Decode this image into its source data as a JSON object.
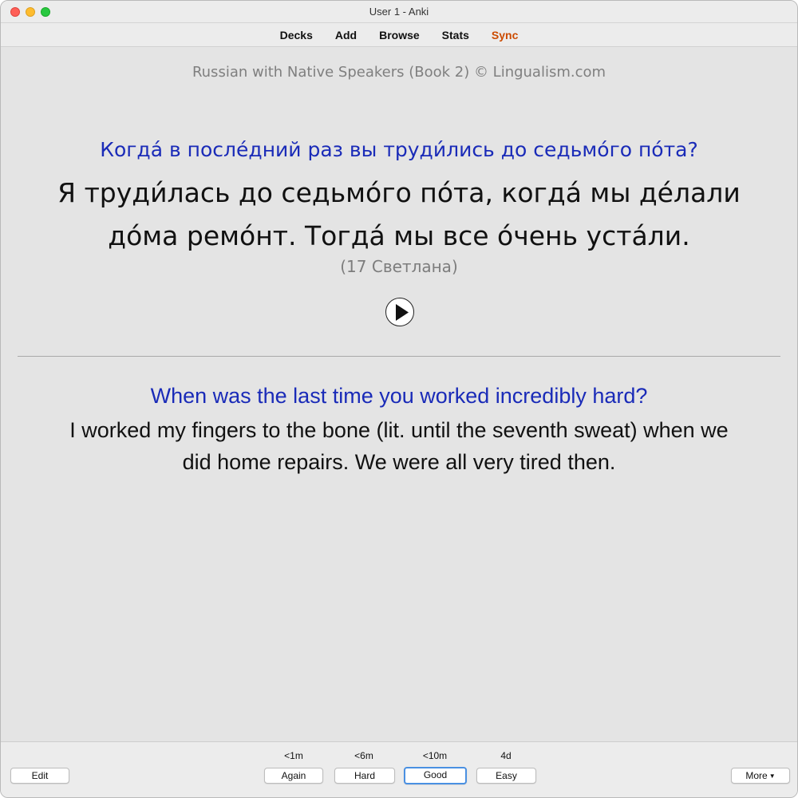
{
  "window": {
    "title": "User 1 - Anki"
  },
  "toolbar": {
    "items": [
      "Decks",
      "Add",
      "Browse",
      "Stats",
      "Sync"
    ]
  },
  "card": {
    "copyright": "Russian with Native Speakers (Book 2) © Lingualism.com",
    "ru_question": "Когда́ в после́дний раз вы труди́лись до седьмо́го по́та?",
    "ru_answer_line1": "Я труди́лась до седьмо́го по́та, когда́ мы де́лали",
    "ru_answer_line2": "до́ма ремо́нт. Тогда́ мы все о́чень уста́ли.",
    "speaker": "(17 Светлана)",
    "en_question": "When was the last time you worked incredibly hard?",
    "en_answer_line1": "I worked my fingers to the bone (lit. until the seventh sweat) when we",
    "en_answer_line2": "did home repairs. We were all very tired then."
  },
  "bottom": {
    "edit_label": "Edit",
    "more_label": "More",
    "answers": [
      {
        "interval": "<1m",
        "label": "Again"
      },
      {
        "interval": "<6m",
        "label": "Hard"
      },
      {
        "interval": "<10m",
        "label": "Good"
      },
      {
        "interval": "4d",
        "label": "Easy"
      }
    ]
  },
  "colors": {
    "question_blue": "#1a2bb8",
    "sync_orange": "#cc4b00",
    "focus_ring": "#4a90e2"
  }
}
